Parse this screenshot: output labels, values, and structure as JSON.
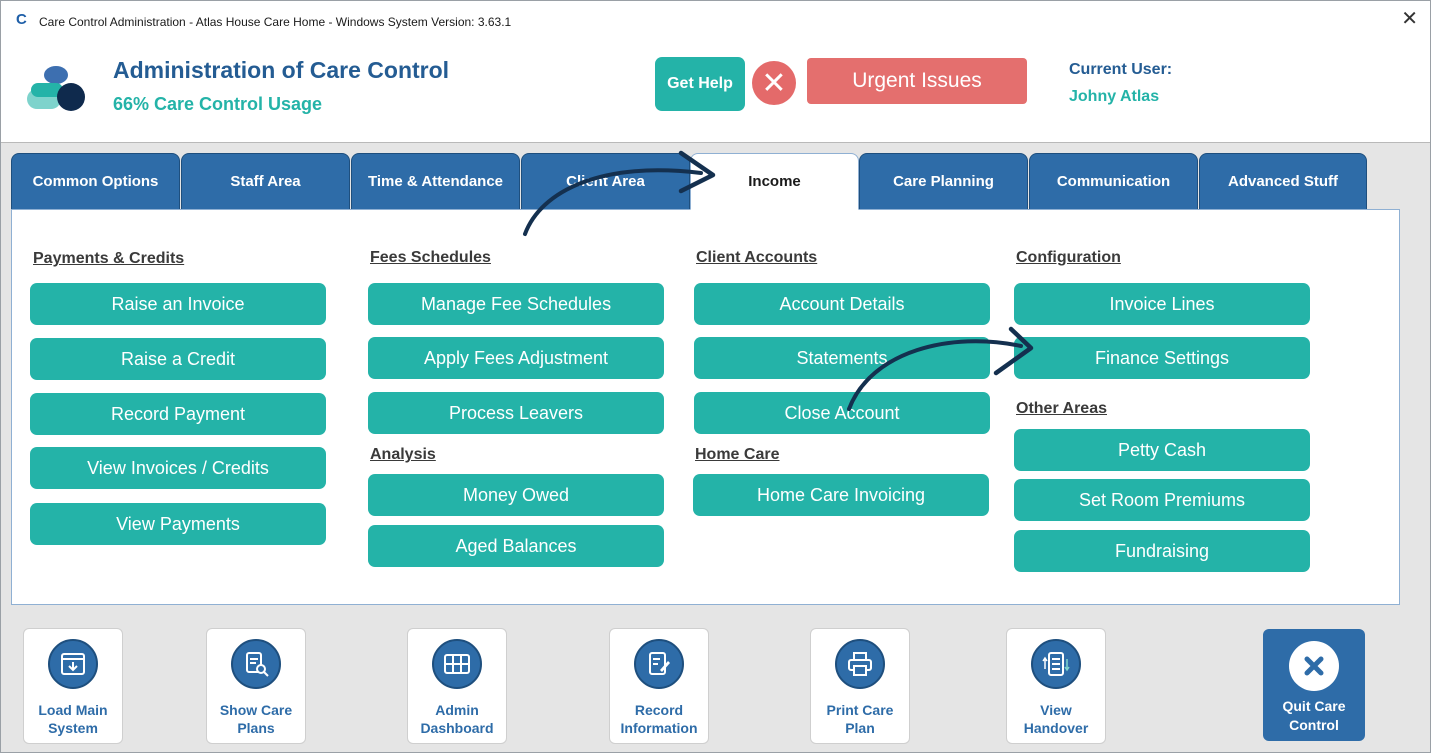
{
  "window": {
    "title": "Care Control Administration - Atlas House Care Home - Windows System Version: 3.63.1",
    "logo_glyph": "C",
    "close_glyph": "✕"
  },
  "header": {
    "title": "Administration of Care Control",
    "usage": "66% Care Control Usage",
    "get_help": "Get Help",
    "urgent_issues": "Urgent Issues",
    "current_user_label": "Current User:",
    "current_user_name": "Johny Atlas"
  },
  "tabs": [
    {
      "label": "Common Options",
      "active": false
    },
    {
      "label": "Staff Area",
      "active": false
    },
    {
      "label": "Time & Attendance",
      "active": false
    },
    {
      "label": "Client Area",
      "active": false
    },
    {
      "label": "Income",
      "active": true
    },
    {
      "label": "Care Planning",
      "active": false
    },
    {
      "label": "Communication",
      "active": false
    },
    {
      "label": "Advanced Stuff",
      "active": false
    }
  ],
  "sections": {
    "payments": {
      "title": "Payments & Credits",
      "buttons": [
        "Raise an Invoice",
        "Raise a Credit",
        "Record Payment",
        "View Invoices / Credits",
        "View Payments"
      ]
    },
    "fees": {
      "title": "Fees Schedules",
      "buttons": [
        "Manage Fee Schedules",
        "Apply Fees Adjustment",
        "Process Leavers"
      ]
    },
    "analysis": {
      "title": "Analysis",
      "buttons": [
        "Money Owed",
        "Aged Balances"
      ]
    },
    "client_accounts": {
      "title": "Client Accounts",
      "buttons": [
        "Account Details",
        "Statements",
        "Close Account"
      ]
    },
    "home_care": {
      "title": "Home Care",
      "buttons": [
        "Home Care Invoicing"
      ]
    },
    "configuration": {
      "title": "Configuration",
      "buttons": [
        "Invoice Lines",
        "Finance Settings"
      ]
    },
    "other_areas": {
      "title": "Other Areas",
      "buttons": [
        "Petty Cash",
        "Set Room Premiums",
        "Fundraising"
      ]
    }
  },
  "toolbar": [
    {
      "line1": "Load Main",
      "line2": "System",
      "icon": "download-window-icon"
    },
    {
      "line1": "Show Care",
      "line2": "Plans",
      "icon": "document-search-icon"
    },
    {
      "line1": "Admin",
      "line2": "Dashboard",
      "icon": "dashboard-grid-icon"
    },
    {
      "line1": "Record",
      "line2": "Information",
      "icon": "edit-document-icon"
    },
    {
      "line1": "Print Care",
      "line2": "Plan",
      "icon": "printer-icon"
    },
    {
      "line1": "View",
      "line2": "Handover",
      "icon": "handover-list-icon"
    }
  ],
  "quit": {
    "line1": "Quit Care",
    "line2": "Control"
  },
  "colors": {
    "teal": "#24b3a8",
    "navy": "#245c93",
    "tab_blue": "#2e6ca8",
    "urgent_red": "#e46f6e",
    "annotation_arrow": "#14304f"
  }
}
